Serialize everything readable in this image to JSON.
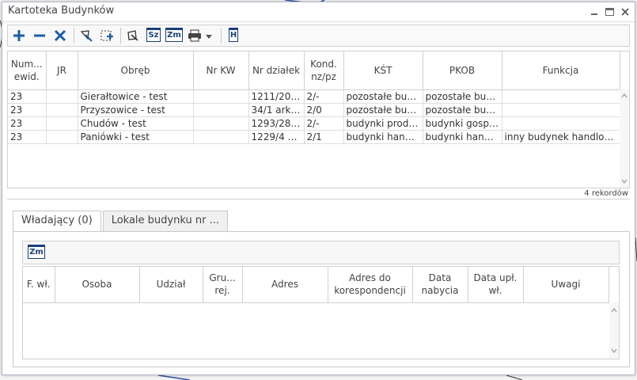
{
  "window": {
    "title": "Kartoteka Budynków"
  },
  "toolbar": {
    "buttons": [
      {
        "icon": "plus-icon"
      },
      {
        "icon": "minus-icon"
      },
      {
        "icon": "x-icon"
      },
      {
        "icon": "edit-pin-icon"
      },
      {
        "icon": "select-add-icon"
      },
      {
        "icon": "map-pin-icon"
      },
      {
        "icon": "sz-icon",
        "label": "Sz"
      },
      {
        "icon": "zm-icon",
        "label": "Zm"
      },
      {
        "icon": "print-icon"
      },
      {
        "icon": "h-icon",
        "label": "H"
      }
    ]
  },
  "grid": {
    "headers": [
      "Num... ewid.",
      "JR",
      "Obręb",
      "Nr KW",
      "Nr działek",
      "Kond. nz/pz",
      "KŚT",
      "PKOB",
      "Funkcja"
    ],
    "rows": [
      [
        "23",
        "",
        "Gierałtowice - test",
        "",
        "1211/20 ...",
        "2/-",
        "pozostałe budy...",
        "pozostałe budy...",
        ""
      ],
      [
        "23",
        "",
        "Przyszowice - test",
        "",
        "34/1 ark. ...",
        "2/0",
        "pozostałe budy...",
        "pozostałe budy...",
        ""
      ],
      [
        "23",
        "",
        "Chudów - test",
        "",
        "1293/287...",
        "2/-",
        "budynki produk...",
        "budynki gospo...",
        ""
      ],
      [
        "23",
        "",
        "Paniówki - test",
        "",
        "1229/4 ar...",
        "2/1",
        "budynki handlo...",
        "budynki handlo...",
        "inny budynek handlow..."
      ]
    ],
    "record_count": "4 rekordów"
  },
  "tabs": [
    {
      "label": "Władający (0)",
      "active": true
    },
    {
      "label": "Lokale budynku nr ...",
      "active": false
    }
  ],
  "owners": {
    "toolbar": {
      "zm_label": "Zm"
    },
    "headers": [
      "F. wł.",
      "Osoba",
      "Udział",
      "Gru... rej.",
      "Adres",
      "Adres do korespondencji",
      "Data nabycia",
      "Data upł. wł.",
      "Uwagi"
    ]
  },
  "colors": {
    "accent": "#1a5ea8",
    "delete": "#1a5ea8",
    "border": "#d0d0d0"
  }
}
